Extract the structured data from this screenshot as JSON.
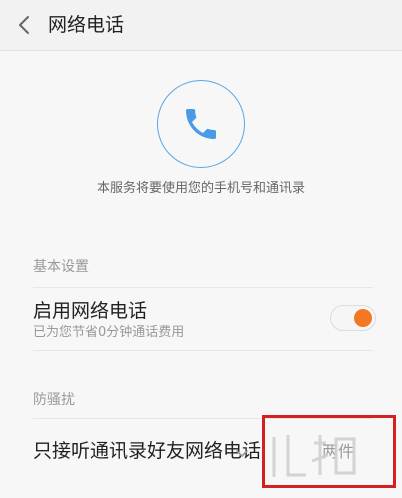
{
  "header": {
    "title": "网络电话"
  },
  "icons": {
    "back": "chevron-left-icon",
    "phone": "phone-icon",
    "chevron": "chevron-down-icon"
  },
  "hero": {
    "description": "本服务将要使用您的手机号和通讯录"
  },
  "sections": {
    "basic": {
      "label": "基本设置"
    },
    "harassment": {
      "label": "防骚扰"
    }
  },
  "rows": {
    "enable": {
      "title": "启用网络电话",
      "subtitle": "已为您节省0分钟通话费用",
      "toggle_on": true
    },
    "contacts_only": {
      "title": "只接听通讯录好友网络电话",
      "value": "两件"
    }
  },
  "colors": {
    "accent": "#f47722",
    "phone_blue": "#4a9be6",
    "highlight": "#d42020"
  }
}
